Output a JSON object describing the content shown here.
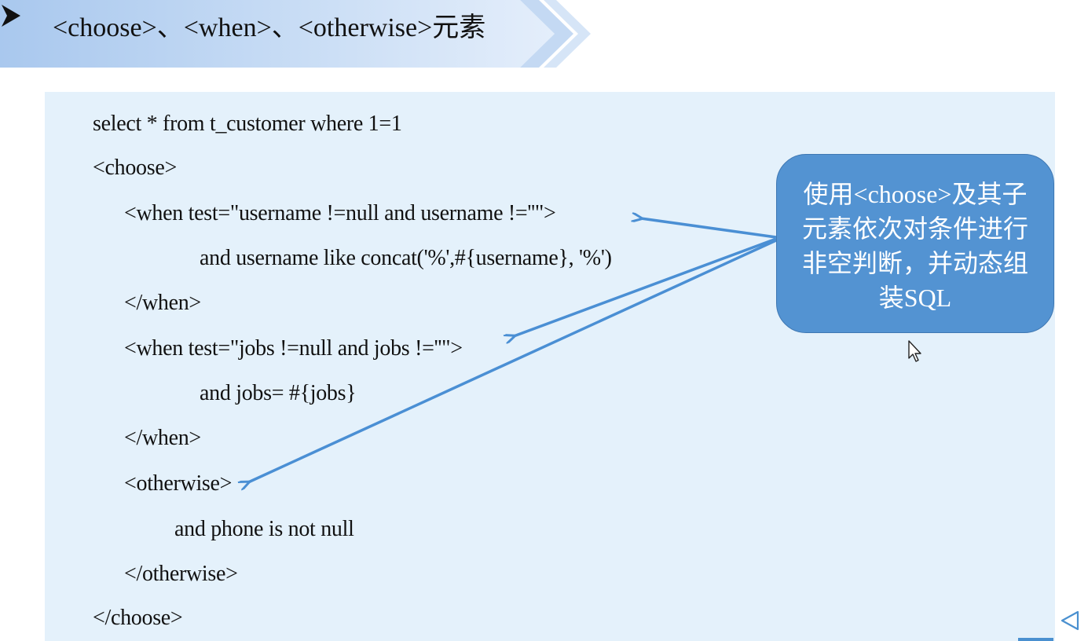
{
  "title": {
    "bullet_icon": "arrow-bullet-icon",
    "text": "<choose>、<when>、<otherwise>元素"
  },
  "code": {
    "lines": [
      "select * from t_customer where 1=1",
      "<choose>",
      "<when test=\"username !=null and username !=''\">",
      "and username like concat('%',#{username}, '%')",
      "</when>",
      "<when test=\"jobs !=null and jobs !=''\">",
      "and jobs= #{jobs}",
      "</when>",
      "<otherwise>",
      "and phone is not null",
      "</otherwise>",
      "</choose>"
    ]
  },
  "callout": {
    "text": "使用<choose>及其子元素依次对条件进行非空判断，并动态组装SQL"
  },
  "colors": {
    "banner_light": "#e6f0fb",
    "banner_dark": "#9fc1ea",
    "panel_background": "#e4f1fb",
    "callout_fill": "#5393d2",
    "arrow": "#4a8fd4"
  },
  "icons": {
    "cursor": "mouse-cursor-icon",
    "previous": "previous-slide-icon"
  }
}
